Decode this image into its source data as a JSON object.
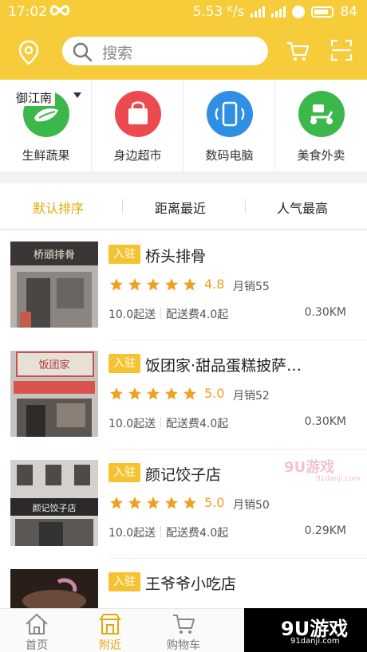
{
  "status_bar": {
    "time": "17:02",
    "speed": "5.53 ᴷ/s",
    "battery": "84"
  },
  "search": {
    "placeholder": "搜索"
  },
  "location": {
    "label": "御江南"
  },
  "categories": [
    {
      "label": "生鲜蔬果",
      "icon": "vegetable-icon",
      "color": "#3cb84a"
    },
    {
      "label": "身边超市",
      "icon": "shopping-bag-icon",
      "color": "#ec4a4f"
    },
    {
      "label": "数码电脑",
      "icon": "phone-icon",
      "color": "#2f8fe3"
    },
    {
      "label": "美食外卖",
      "icon": "scooter-icon",
      "color": "#3cb84a"
    }
  ],
  "sort_tabs": [
    {
      "label": "默认排序",
      "active": true
    },
    {
      "label": "距离最近",
      "active": false
    },
    {
      "label": "人气最高",
      "active": false
    }
  ],
  "shops": [
    {
      "badge": "入驻",
      "name": "桥头排骨",
      "rating": "4.8",
      "sales": "月销55",
      "min_price": "10.0起送",
      "delivery_fee": "配送费4.0起",
      "distance": "0.30KM",
      "stars": 5,
      "sign_text": "桥頭排骨"
    },
    {
      "badge": "入驻",
      "name": "饭团家·甜品蛋糕披萨…",
      "rating": "5.0",
      "sales": "月销52",
      "min_price": "10.0起送",
      "delivery_fee": "配送费4.0起",
      "distance": "0.30KM",
      "stars": 5,
      "sign_text": "饭团家"
    },
    {
      "badge": "入驻",
      "name": "颜记饺子店",
      "rating": "5.0",
      "sales": "月销50",
      "min_price": "10.0起送",
      "delivery_fee": "配送费4.0起",
      "distance": "0.29KM",
      "stars": 5,
      "sign_text": "颜记饺子店"
    },
    {
      "badge": "入驻",
      "name": "王爷爷小吃店",
      "rating": "",
      "sales": "",
      "min_price": "",
      "delivery_fee": "",
      "distance": "",
      "stars": 0,
      "sign_text": ""
    }
  ],
  "bottom_nav": [
    {
      "label": "首页",
      "icon": "home-icon",
      "active": false
    },
    {
      "label": "附近",
      "icon": "nearby-icon",
      "active": true
    },
    {
      "label": "购物车",
      "icon": "cart-icon",
      "active": false
    }
  ],
  "watermark": {
    "top": "9U游戏",
    "top_url": "91danji.com",
    "bottom": "9U游戏",
    "bottom_url": "91danji.com"
  },
  "colors": {
    "accent": "#f7cc3a",
    "active_tab": "#e2a90c",
    "star": "#f0a020"
  }
}
